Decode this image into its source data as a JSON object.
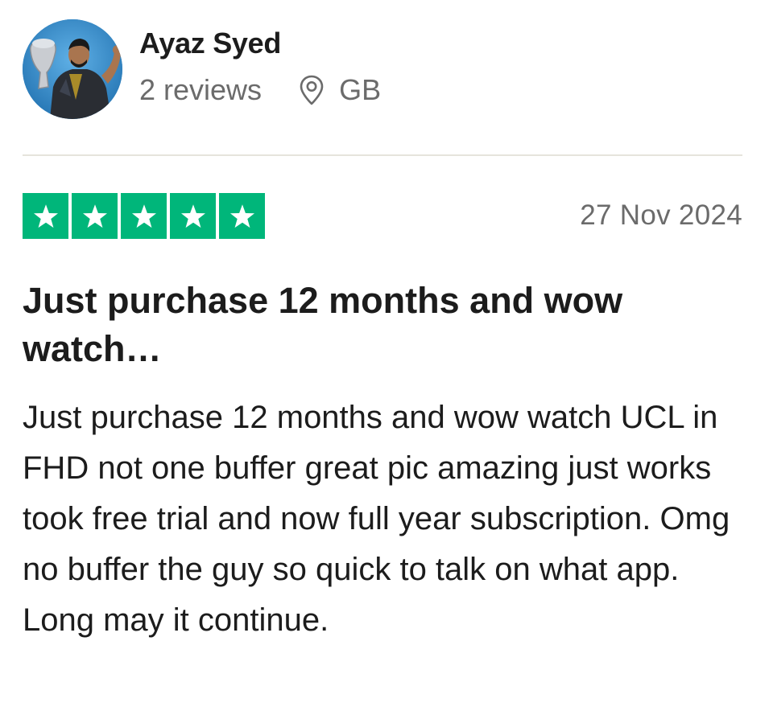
{
  "reviewer": {
    "name": "Ayaz Syed",
    "reviews_count": "2 reviews",
    "country": "GB"
  },
  "review": {
    "rating": 5,
    "rating_max": 5,
    "date": "27 Nov 2024",
    "title": "Just purchase 12 months and wow watch…",
    "body": "Just purchase 12 months and wow watch UCL in FHD not one buffer great pic amazing just works took free trial and now full year subscription. Omg no buffer the guy so quick to talk on what app. Long may it continue."
  },
  "icons": {
    "location": "map-pin-icon",
    "star": "star-icon"
  },
  "colors": {
    "star_fill": "#00b67a",
    "name_text": "#1c1c1c",
    "meta_text": "#6b6b6b",
    "divider": "#e6e4dc"
  }
}
